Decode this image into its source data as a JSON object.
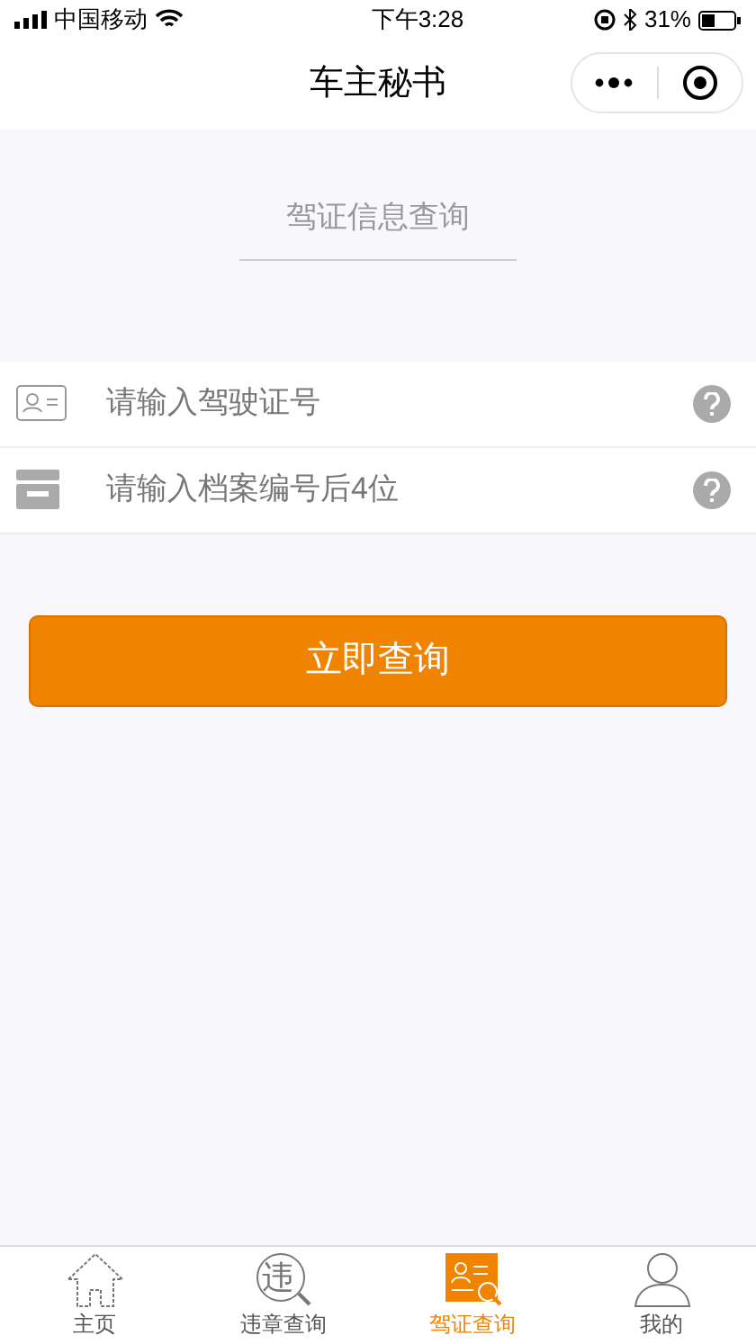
{
  "status_bar": {
    "carrier": "中国移动",
    "time": "下午3:28",
    "battery": "31%"
  },
  "nav": {
    "title": "车主秘书"
  },
  "section_title": "驾证信息查询",
  "fields": [
    {
      "kind": "license",
      "placeholder": "请输入驾驶证号"
    },
    {
      "kind": "archive",
      "placeholder": "请输入档案编号后4位"
    }
  ],
  "submit": "立即查询",
  "tabs": [
    {
      "kind": "home",
      "label": "主页",
      "selected": false
    },
    {
      "kind": "violation",
      "label": "违章查询",
      "icon_text": "违",
      "selected": false
    },
    {
      "kind": "license",
      "label": "驾证查询",
      "selected": true
    },
    {
      "kind": "profile",
      "label": "我的",
      "selected": false
    }
  ]
}
